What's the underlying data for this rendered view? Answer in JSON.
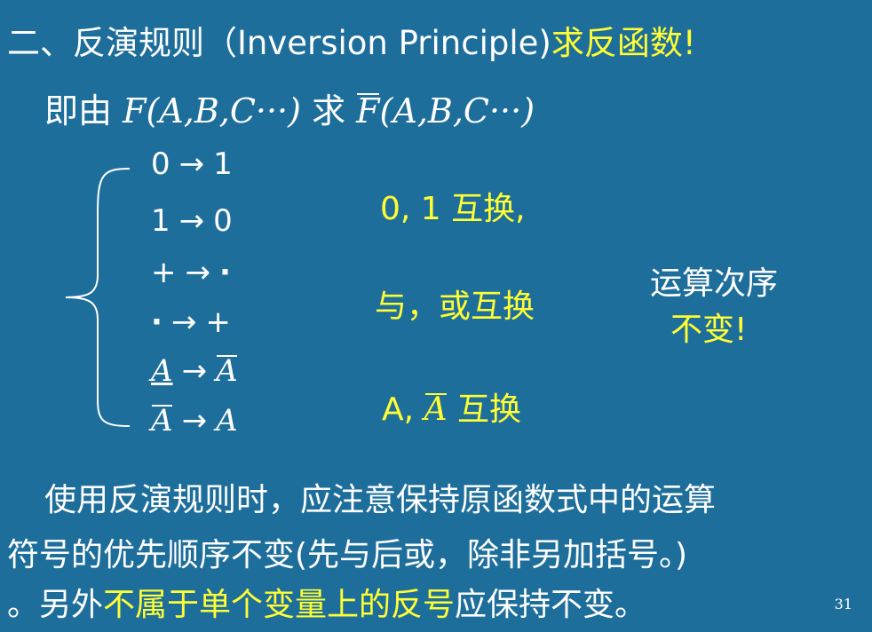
{
  "title": {
    "white": "二、反演规则（Inversion Principle)",
    "yellow": "求反函数!"
  },
  "subtitle": {
    "prefix": "即由",
    "expr1": "F(A,B,C···)",
    "mid": "求",
    "f_bar": "F",
    "expr2_rest": "(A,B,C···)"
  },
  "rules": [
    {
      "from": "0",
      "arrow": "→",
      "to": "1"
    },
    {
      "from": "1",
      "arrow": "→",
      "to": "0"
    },
    {
      "from": "+",
      "arrow": "→",
      "to": "·"
    },
    {
      "from": "·",
      "arrow": "→",
      "to": "+"
    },
    {
      "from": "A",
      "arrow": "→",
      "to": "A"
    },
    {
      "from": "A",
      "arrow": "→",
      "to": "A"
    }
  ],
  "notes": {
    "swap01": "0, 1 互换,",
    "swap_and_or": "与，或互换",
    "swap_a_prefix": "A,",
    "swap_a_bar": "A",
    "swap_a_suffix": "互换"
  },
  "order": {
    "line1": "运算次序",
    "line2": "不变!"
  },
  "paragraph": {
    "line1": "使用反演规则时，应注意保持原函数式中的运算",
    "line2": "符号的优先顺序不变(先与后或，除非另加括号。)",
    "line3_a": "。另外",
    "line3_b": "不属于单个变量上的反号",
    "line3_c": "应保持不变。"
  },
  "page_number": "31"
}
